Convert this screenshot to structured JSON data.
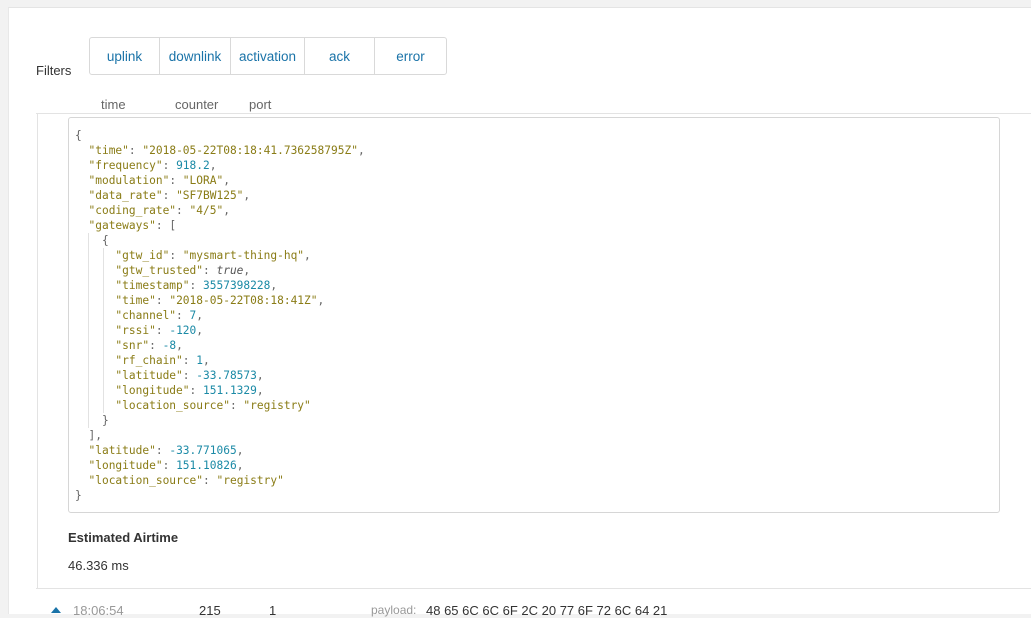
{
  "filters": {
    "label": "Filters",
    "buttons": [
      {
        "name": "uplink",
        "label": "uplink"
      },
      {
        "name": "downlink",
        "label": "downlink"
      },
      {
        "name": "activation",
        "label": "activation"
      },
      {
        "name": "ack",
        "label": "ack"
      },
      {
        "name": "error",
        "label": "error"
      }
    ]
  },
  "columns": {
    "time": "time",
    "counter": "counter",
    "port": "port"
  },
  "message": {
    "json_lines": [
      [
        {
          "t": "p",
          "v": "{"
        }
      ],
      [
        {
          "t": "p",
          "v": "  "
        },
        {
          "t": "k",
          "v": "\"time\""
        },
        {
          "t": "p",
          "v": ": "
        },
        {
          "t": "s",
          "v": "\"2018-05-22T08:18:41.736258795Z\""
        },
        {
          "t": "p",
          "v": ","
        }
      ],
      [
        {
          "t": "p",
          "v": "  "
        },
        {
          "t": "k",
          "v": "\"frequency\""
        },
        {
          "t": "p",
          "v": ": "
        },
        {
          "t": "n",
          "v": "918.2"
        },
        {
          "t": "p",
          "v": ","
        }
      ],
      [
        {
          "t": "p",
          "v": "  "
        },
        {
          "t": "k",
          "v": "\"modulation\""
        },
        {
          "t": "p",
          "v": ": "
        },
        {
          "t": "s",
          "v": "\"LORA\""
        },
        {
          "t": "p",
          "v": ","
        }
      ],
      [
        {
          "t": "p",
          "v": "  "
        },
        {
          "t": "k",
          "v": "\"data_rate\""
        },
        {
          "t": "p",
          "v": ": "
        },
        {
          "t": "s",
          "v": "\"SF7BW125\""
        },
        {
          "t": "p",
          "v": ","
        }
      ],
      [
        {
          "t": "p",
          "v": "  "
        },
        {
          "t": "k",
          "v": "\"coding_rate\""
        },
        {
          "t": "p",
          "v": ": "
        },
        {
          "t": "s",
          "v": "\"4/5\""
        },
        {
          "t": "p",
          "v": ","
        }
      ],
      [
        {
          "t": "p",
          "v": "  "
        },
        {
          "t": "k",
          "v": "\"gateways\""
        },
        {
          "t": "p",
          "v": ": ["
        }
      ],
      [
        {
          "t": "p",
          "v": "    {"
        }
      ],
      [
        {
          "t": "p",
          "v": "      "
        },
        {
          "t": "k",
          "v": "\"gtw_id\""
        },
        {
          "t": "p",
          "v": ": "
        },
        {
          "t": "s",
          "v": "\"mysmart-thing-hq\""
        },
        {
          "t": "p",
          "v": ","
        }
      ],
      [
        {
          "t": "p",
          "v": "      "
        },
        {
          "t": "k",
          "v": "\"gtw_trusted\""
        },
        {
          "t": "p",
          "v": ": "
        },
        {
          "t": "b",
          "v": "true"
        },
        {
          "t": "p",
          "v": ","
        }
      ],
      [
        {
          "t": "p",
          "v": "      "
        },
        {
          "t": "k",
          "v": "\"timestamp\""
        },
        {
          "t": "p",
          "v": ": "
        },
        {
          "t": "n",
          "v": "3557398228"
        },
        {
          "t": "p",
          "v": ","
        }
      ],
      [
        {
          "t": "p",
          "v": "      "
        },
        {
          "t": "k",
          "v": "\"time\""
        },
        {
          "t": "p",
          "v": ": "
        },
        {
          "t": "s",
          "v": "\"2018-05-22T08:18:41Z\""
        },
        {
          "t": "p",
          "v": ","
        }
      ],
      [
        {
          "t": "p",
          "v": "      "
        },
        {
          "t": "k",
          "v": "\"channel\""
        },
        {
          "t": "p",
          "v": ": "
        },
        {
          "t": "n",
          "v": "7"
        },
        {
          "t": "p",
          "v": ","
        }
      ],
      [
        {
          "t": "p",
          "v": "      "
        },
        {
          "t": "k",
          "v": "\"rssi\""
        },
        {
          "t": "p",
          "v": ": "
        },
        {
          "t": "n",
          "v": "-120"
        },
        {
          "t": "p",
          "v": ","
        }
      ],
      [
        {
          "t": "p",
          "v": "      "
        },
        {
          "t": "k",
          "v": "\"snr\""
        },
        {
          "t": "p",
          "v": ": "
        },
        {
          "t": "n",
          "v": "-8"
        },
        {
          "t": "p",
          "v": ","
        }
      ],
      [
        {
          "t": "p",
          "v": "      "
        },
        {
          "t": "k",
          "v": "\"rf_chain\""
        },
        {
          "t": "p",
          "v": ": "
        },
        {
          "t": "n",
          "v": "1"
        },
        {
          "t": "p",
          "v": ","
        }
      ],
      [
        {
          "t": "p",
          "v": "      "
        },
        {
          "t": "k",
          "v": "\"latitude\""
        },
        {
          "t": "p",
          "v": ": "
        },
        {
          "t": "n",
          "v": "-33.78573"
        },
        {
          "t": "p",
          "v": ","
        }
      ],
      [
        {
          "t": "p",
          "v": "      "
        },
        {
          "t": "k",
          "v": "\"longitude\""
        },
        {
          "t": "p",
          "v": ": "
        },
        {
          "t": "n",
          "v": "151.1329"
        },
        {
          "t": "p",
          "v": ","
        }
      ],
      [
        {
          "t": "p",
          "v": "      "
        },
        {
          "t": "k",
          "v": "\"location_source\""
        },
        {
          "t": "p",
          "v": ": "
        },
        {
          "t": "s",
          "v": "\"registry\""
        }
      ],
      [
        {
          "t": "p",
          "v": "    }"
        }
      ],
      [
        {
          "t": "p",
          "v": "  ],"
        }
      ],
      [
        {
          "t": "p",
          "v": "  "
        },
        {
          "t": "k",
          "v": "\"latitude\""
        },
        {
          "t": "p",
          "v": ": "
        },
        {
          "t": "n",
          "v": "-33.771065"
        },
        {
          "t": "p",
          "v": ","
        }
      ],
      [
        {
          "t": "p",
          "v": "  "
        },
        {
          "t": "k",
          "v": "\"longitude\""
        },
        {
          "t": "p",
          "v": ": "
        },
        {
          "t": "n",
          "v": "151.10826"
        },
        {
          "t": "p",
          "v": ","
        }
      ],
      [
        {
          "t": "p",
          "v": "  "
        },
        {
          "t": "k",
          "v": "\"location_source\""
        },
        {
          "t": "p",
          "v": ": "
        },
        {
          "t": "s",
          "v": "\"registry\""
        }
      ],
      [
        {
          "t": "p",
          "v": "}"
        }
      ]
    ],
    "airtime_label": "Estimated Airtime",
    "airtime_value": "46.336 ms"
  },
  "next_row": {
    "time": "18:06:54",
    "counter": "215",
    "port": "1",
    "payload_label": "payload:",
    "payload_value": "48 65 6C 6C 6F 2C 20 77 6F 72 6C 64 21"
  },
  "colors": {
    "key": "#8a7c16",
    "number": "#1b8aa6",
    "link": "#1a73a8"
  }
}
